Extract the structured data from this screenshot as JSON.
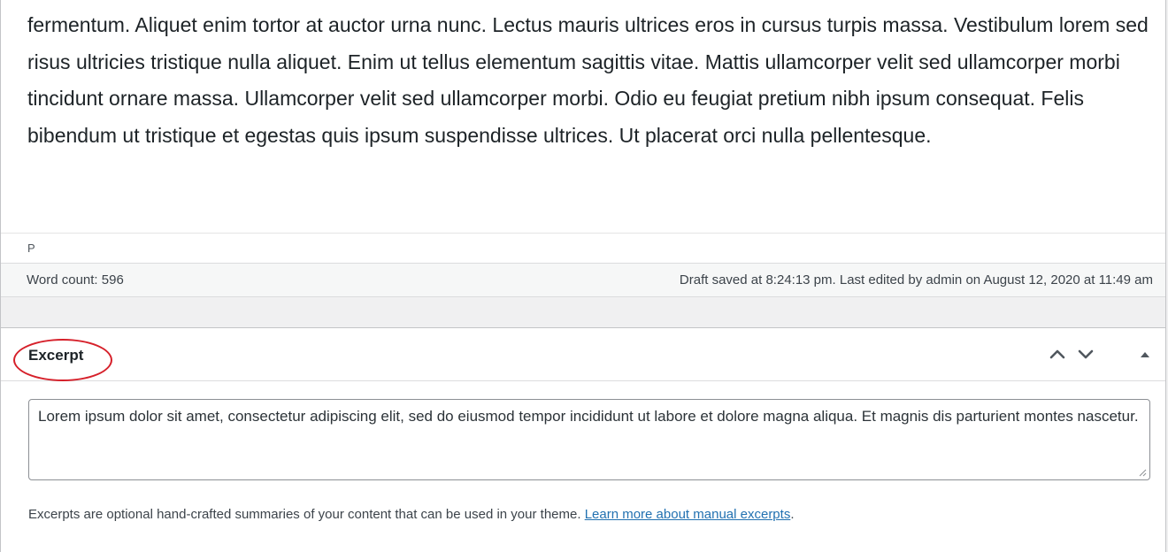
{
  "editor": {
    "content": "fermentum. Aliquet enim tortor at auctor urna nunc. Lectus mauris ultrices eros in cursus turpis massa. Vestibulum lorem sed risus ultricies tristique nulla aliquet. Enim ut tellus elementum sagittis vitae. Mattis ullamcorper velit sed ullamcorper morbi tincidunt ornare massa. Ullamcorper velit sed ullamcorper morbi. Odio eu feugiat pretium nibh ipsum consequat. Felis bibendum ut tristique et egestas quis ipsum suspendisse ultrices. Ut placerat orci nulla pellentesque.",
    "path": "P"
  },
  "status_bar": {
    "word_count": "Word count: 596",
    "draft_status": "Draft saved at 8:24:13 pm. Last edited by admin on August 12, 2020 at 11:49 am"
  },
  "excerpt": {
    "title": "Excerpt",
    "value": "Lorem ipsum dolor sit amet, consectetur adipiscing elit, sed do eiusmod tempor incididunt ut labore et dolore magna aliqua. Et magnis dis parturient montes nascetur.",
    "help_text": "Excerpts are optional hand-crafted summaries of your content that can be used in your theme.",
    "help_link": "Learn more about manual excerpts",
    "help_suffix": ".",
    "buttons": {
      "move_up_icon": "chevron-up-icon",
      "move_down_icon": "chevron-down-icon",
      "toggle_icon": "caret-up-icon"
    },
    "highlight_color": "#d6202a"
  },
  "colors": {
    "link": "#2271b1",
    "text": "#1d2327",
    "status_bg": "#f6f7f7"
  }
}
